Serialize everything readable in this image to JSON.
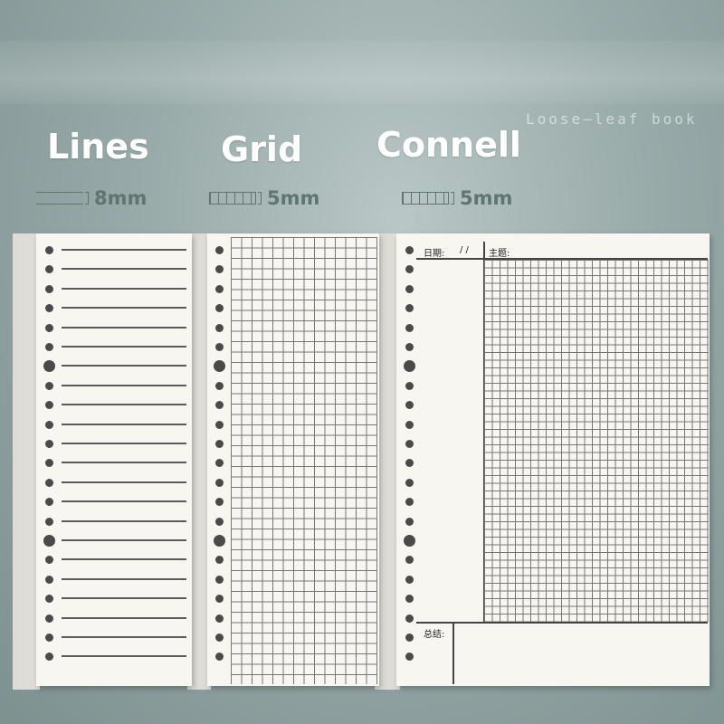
{
  "tagline": "Loose—leaf book",
  "titles": {
    "lines": "Lines",
    "grid": "Grid",
    "connell": "Connell"
  },
  "specs": {
    "lines": "8mm",
    "grid": "5mm",
    "connell": "5mm"
  },
  "connell_page": {
    "date_label": "日期:",
    "date_slashes": "/   /",
    "topic_label": "主题:",
    "summary_label": "总结:"
  },
  "colors": {
    "background": "#98aaa9",
    "paper": "#f7f6f0",
    "spec_text": "#61746f",
    "title_text": "#ffffff"
  }
}
